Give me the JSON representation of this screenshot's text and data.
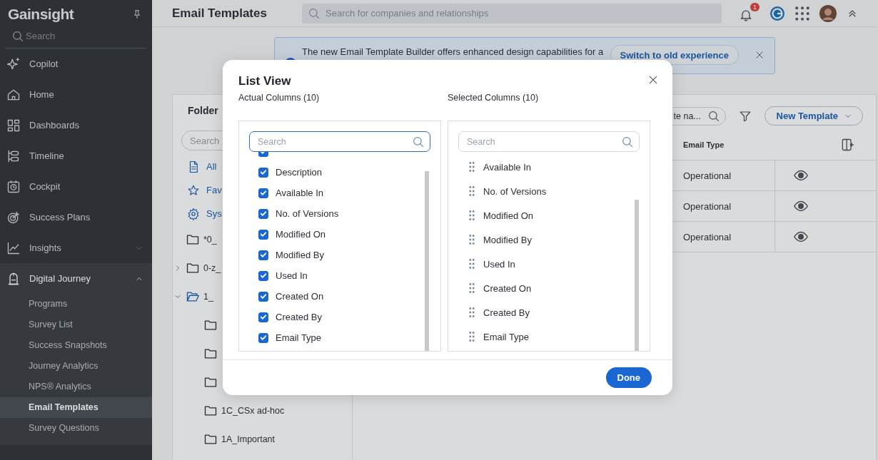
{
  "sidebar": {
    "logo": "Gainsight",
    "search": {
      "placeholder": "Search"
    },
    "items": [
      {
        "label": "Copilot"
      },
      {
        "label": "Home"
      },
      {
        "label": "Dashboards"
      },
      {
        "label": "Timeline"
      },
      {
        "label": "Cockpit"
      },
      {
        "label": "Success Plans"
      },
      {
        "label": "Insights",
        "expanded": false
      },
      {
        "label": "Digital Journey",
        "expanded": true,
        "children": [
          {
            "label": "Programs",
            "selected": false
          },
          {
            "label": "Survey List",
            "selected": false
          },
          {
            "label": "Success Snapshots",
            "selected": false
          },
          {
            "label": "Journey Analytics",
            "selected": false
          },
          {
            "label": "NPS® Analytics",
            "selected": false
          },
          {
            "label": "Email Templates",
            "selected": true
          },
          {
            "label": "Survey Questions",
            "selected": false
          }
        ]
      }
    ]
  },
  "topbar": {
    "title": "Email Templates",
    "search": {
      "placeholder": "Search for companies and relationships"
    },
    "notifications": "1"
  },
  "banner": {
    "text": "The new Email Template Builder offers enhanced design capabilities for a",
    "button": "Switch to old experience"
  },
  "folders": {
    "title": "Folder",
    "search": {
      "placeholder": "Search"
    },
    "links": [
      {
        "label": "All"
      },
      {
        "label": "Fav"
      },
      {
        "label": "Sys"
      }
    ],
    "tree": [
      {
        "kind": "folder",
        "name": "*0_"
      },
      {
        "kind": "folder",
        "name": "0-z_",
        "expanded": false
      },
      {
        "kind": "folder",
        "name": "1_",
        "expanded": true,
        "children": [
          {
            "kind": "folder"
          },
          {
            "kind": "folder"
          },
          {
            "kind": "folder"
          },
          {
            "kind": "folder",
            "name": "1C_CSx ad-hoc"
          },
          {
            "kind": "folder",
            "name": "1A_Important"
          }
        ]
      }
    ]
  },
  "table": {
    "search": {
      "value": "te na..."
    },
    "new_button": "New Template",
    "columns": [
      "Email Type"
    ],
    "rows": [
      {
        "email_type": "Operational"
      },
      {
        "email_type": "Operational"
      },
      {
        "email_type": "Operational"
      }
    ]
  },
  "modal": {
    "title": "List View",
    "actual": {
      "heading": "Actual Columns (10)",
      "search": {
        "placeholder": "Search"
      },
      "items": [
        {
          "checked": true
        },
        {
          "label": "Description",
          "checked": true
        },
        {
          "label": "Available In",
          "checked": true
        },
        {
          "label": "No. of Versions",
          "checked": true
        },
        {
          "label": "Modified On",
          "checked": true
        },
        {
          "label": "Modified By",
          "checked": true
        },
        {
          "label": "Used In",
          "checked": true
        },
        {
          "label": "Created On",
          "checked": true
        },
        {
          "label": "Created By",
          "checked": true
        },
        {
          "label": "Email Type",
          "checked": true
        }
      ]
    },
    "selected": {
      "heading": "Selected Columns (10)",
      "search": {
        "placeholder": "Search"
      },
      "items": [
        "Available In",
        "No. of Versions",
        "Modified On",
        "Modified By",
        "Used In",
        "Created On",
        "Created By",
        "Email Type"
      ]
    },
    "done": "Done"
  }
}
